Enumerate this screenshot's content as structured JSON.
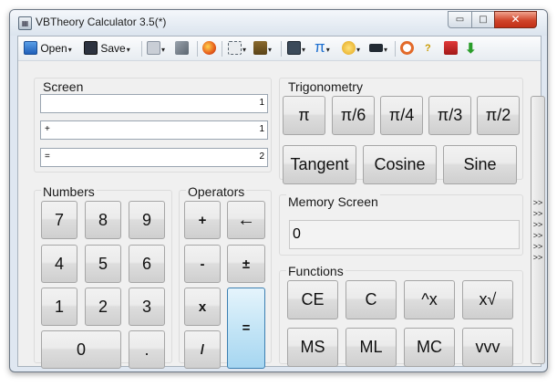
{
  "window": {
    "title": "VBTheory Calculator 3.5(*)",
    "minimize_glyph": "▭",
    "maximize_glyph": "□",
    "close_glyph": "✕"
  },
  "toolbar": {
    "open_label": "Open",
    "save_label": "Save",
    "pi_glyph": "π",
    "help_glyph": "?",
    "dropdown_glyph": "▾"
  },
  "screen_group": {
    "label": "Screen",
    "lines": [
      {
        "left": "",
        "right": "1"
      },
      {
        "left": "+",
        "right": "1"
      },
      {
        "left": "=",
        "right": "2"
      }
    ]
  },
  "numbers_group": {
    "label": "Numbers",
    "keys": [
      "7",
      "8",
      "9",
      "4",
      "5",
      "6",
      "1",
      "2",
      "3",
      "0",
      "."
    ]
  },
  "operators_group": {
    "label": "Operators",
    "keys": [
      "+",
      "←",
      "-",
      "±",
      "x",
      "/",
      "="
    ]
  },
  "trig_group": {
    "label": "Trigonometry",
    "constants": [
      "π",
      "π/6",
      "π/4",
      "π/3",
      "π/2"
    ],
    "functions": [
      "Tangent",
      "Cosine",
      "Sine"
    ]
  },
  "memory_group": {
    "label": "Memory Screen",
    "value": "0"
  },
  "functions_group": {
    "label": "Functions",
    "keys": [
      "CE",
      "C",
      "^x",
      "x√",
      "MS",
      "ML",
      "MC",
      "vvv"
    ]
  },
  "side_panel": {
    "arrows": ">>\n>>\n>>\n>>\n>>\n>>"
  }
}
